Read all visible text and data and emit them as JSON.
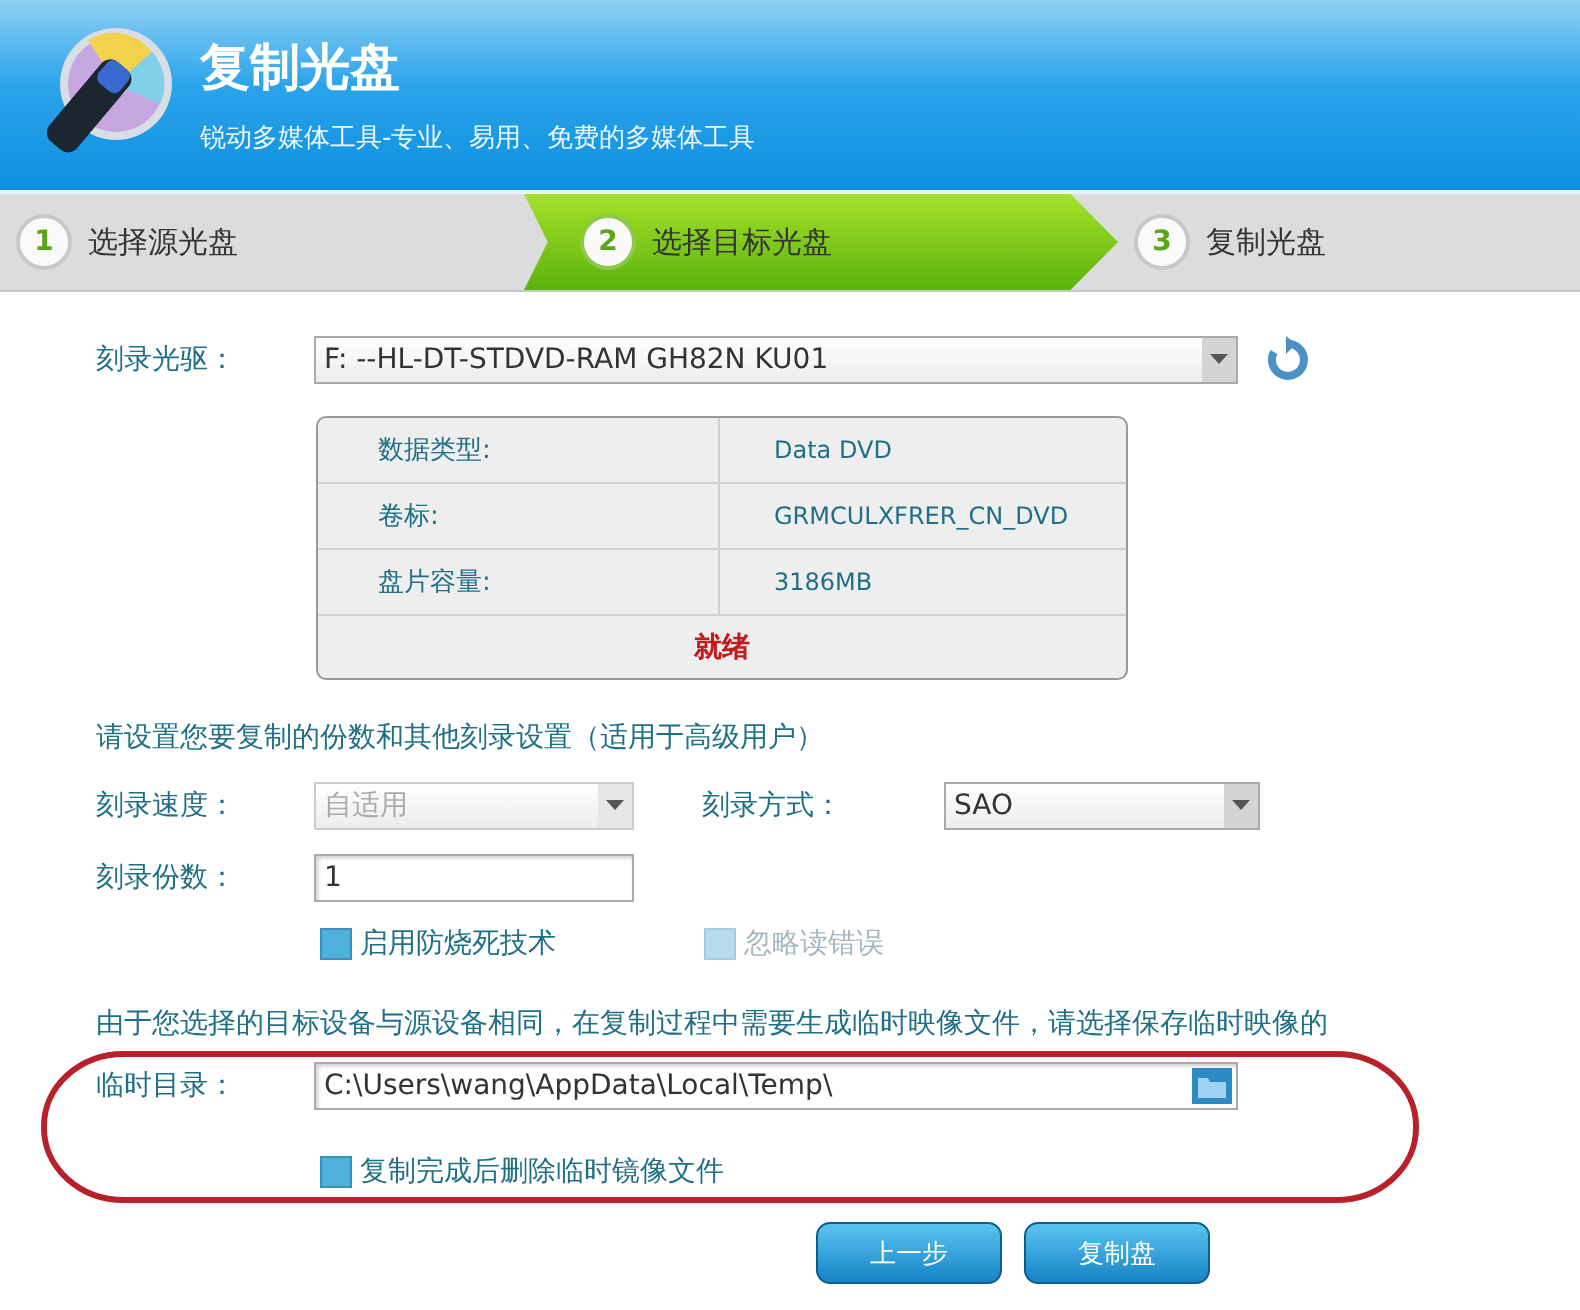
{
  "header": {
    "title": "复制光盘",
    "subtitle": "锐动多媒体工具-专业、易用、免费的多媒体工具"
  },
  "steps": [
    {
      "number": "1",
      "label": "选择源光盘",
      "selected": false
    },
    {
      "number": "2",
      "label": "选择目标光盘",
      "selected": true
    },
    {
      "number": "3",
      "label": "复制光盘",
      "selected": false
    }
  ],
  "drive": {
    "label": "刻录光驱：",
    "value": "F:  --HL-DT-STDVD-RAM GH82N     KU01"
  },
  "disc_info": {
    "rows": [
      {
        "label": "数据类型:",
        "value": "Data DVD"
      },
      {
        "label": "卷标:",
        "value": "GRMCULXFRER_CN_DVD"
      },
      {
        "label": "盘片容量:",
        "value": "3186MB"
      }
    ],
    "status": "就绪"
  },
  "settings": {
    "heading": "请设置您要复制的份数和其他刻录设置（适用于高级用户）",
    "speed": {
      "label": "刻录速度：",
      "value": "自适用",
      "disabled": true
    },
    "mode": {
      "label": "刻录方式：",
      "value": "SAO",
      "disabled": false
    },
    "copies": {
      "label": "刻录份数：",
      "value": "1"
    },
    "options": [
      {
        "label": "启用防烧死技术",
        "checked": true,
        "disabled": false
      },
      {
        "label": "忽略读错误",
        "checked": true,
        "disabled": true
      }
    ]
  },
  "temp": {
    "note": "由于您选择的目标设备与源设备相同，在复制过程中需要生成临时映像文件，请选择保存临时映像的",
    "label": "临时目录：",
    "value": "C:\\Users\\wang\\AppData\\Local\\Temp\\",
    "option": {
      "label": "复制完成后删除临时镜像文件",
      "checked": true,
      "disabled": false
    }
  },
  "annotation": {
    "kind": "ellipse",
    "color": "#b8202a"
  },
  "buttons": [
    {
      "label": "上一步"
    },
    {
      "label": "复制盘"
    }
  ]
}
